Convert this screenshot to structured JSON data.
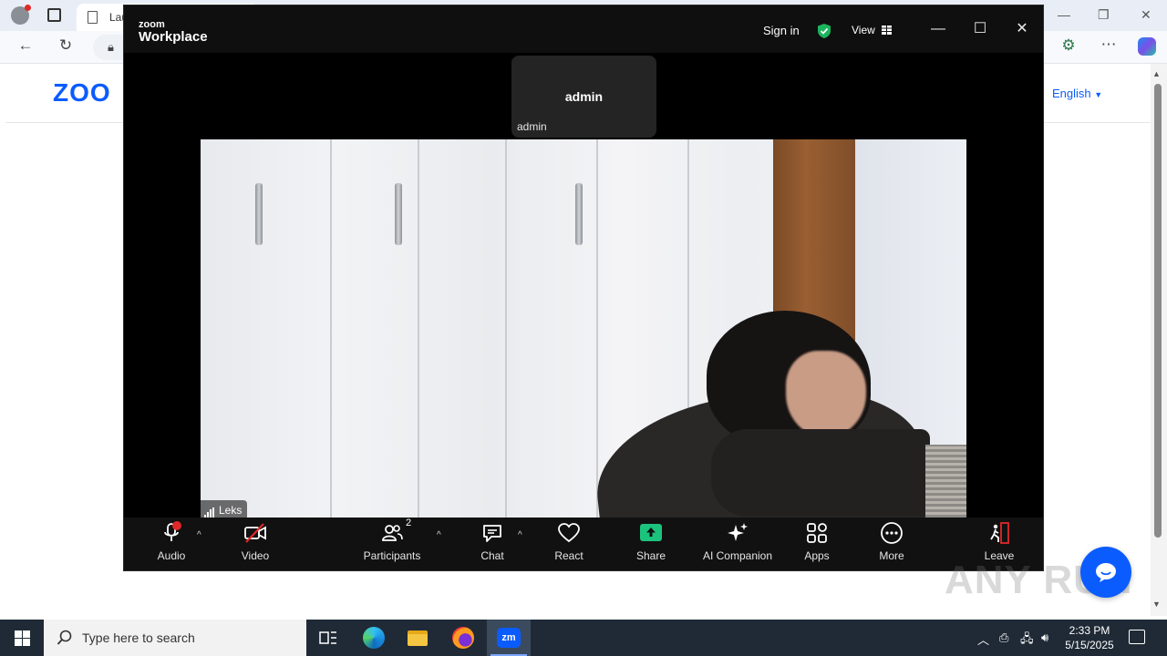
{
  "browser": {
    "tab_title": "Lau",
    "page_logo": "ZOO",
    "language_link": "English"
  },
  "zoom": {
    "brand_small": "zoom",
    "brand_big": "Workplace",
    "sign_in": "Sign in",
    "view_label": "View",
    "self_tile_name": "admin",
    "self_tile_label": "admin",
    "active_speaker_label": "Leks",
    "participants_count": "2",
    "toolbar": {
      "audio": "Audio",
      "video": "Video",
      "participants": "Participants",
      "chat": "Chat",
      "react": "React",
      "share": "Share",
      "ai_companion": "AI Companion",
      "apps": "Apps",
      "more": "More",
      "leave": "Leave"
    },
    "colors": {
      "accent": "#0b5cff",
      "share_green": "#1bc47d",
      "leave_red": "#e02828",
      "shield_green": "#1bb55c"
    }
  },
  "watermark": "ANY RUN",
  "taskbar": {
    "search_placeholder": "Type here to search",
    "time": "2:33 PM",
    "date": "5/15/2025",
    "zoom_app_label": "zm"
  }
}
